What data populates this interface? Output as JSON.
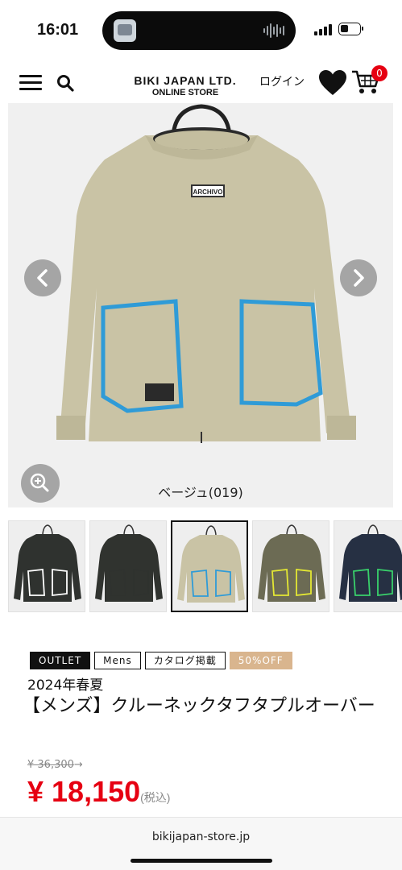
{
  "status": {
    "time": "16:01"
  },
  "header": {
    "brand_line1": "BIKI JAPAN LTD.",
    "brand_line2": "ONLINE STORE",
    "login_label": "ログイン",
    "cart_count": "0",
    "icons": [
      "menu-icon",
      "search-icon",
      "heart-icon",
      "cart-icon"
    ]
  },
  "product": {
    "color_caption": "ベージュ(019)",
    "thumbnail_colors": [
      "#2f322f",
      "#30332f",
      "#c9c3a5",
      "#6c6b54",
      "#263043"
    ],
    "thumbnail_accents": [
      "#ffffff",
      "#2f322f",
      "#2f9bd7",
      "#e4e833",
      "#39d16b"
    ],
    "selected_thumbnail": 3,
    "tags": [
      "OUTLET",
      "Mens",
      "カタログ掲載",
      "50%OFF"
    ],
    "season": "2024年春夏",
    "title": "【メンズ】クルーネックタフタプルオーバー",
    "old_price": "¥ 36,300",
    "old_price_arrow": "→",
    "price": "¥ 18,150",
    "tax_label": "(税込)",
    "badge_text": "ARCHIVO"
  },
  "footer": {
    "url": "bikijapan-store.jp"
  },
  "colors": {
    "accent_red": "#e60012",
    "sale_tag": "#d9b58e"
  }
}
